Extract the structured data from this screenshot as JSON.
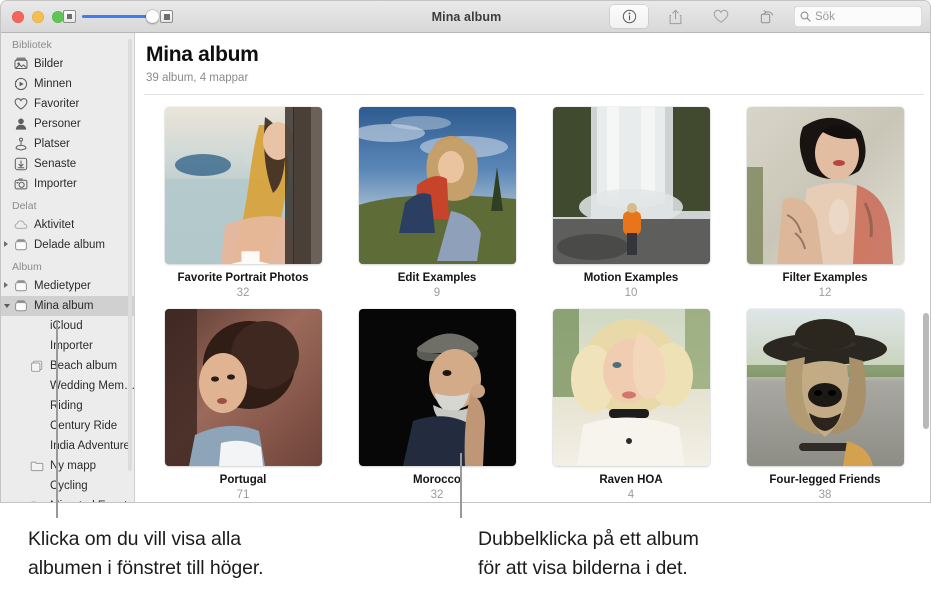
{
  "window": {
    "title": "Mina album",
    "traffic_lights": [
      "close",
      "minimize",
      "zoom"
    ],
    "zoom_slider": {
      "min_icon": "small-thumbnail-icon",
      "max_icon": "large-thumbnail-icon",
      "value_percent": 100
    }
  },
  "toolbar": {
    "buttons": [
      {
        "name": "info-button",
        "icon": "info-circle-icon"
      },
      {
        "name": "share-button",
        "icon": "share-up-arrow-icon"
      },
      {
        "name": "favorite-button",
        "icon": "heart-icon"
      },
      {
        "name": "rotate-button",
        "icon": "rotate-icon"
      }
    ],
    "search": {
      "placeholder": "Sök",
      "value": "",
      "icon": "search-icon"
    }
  },
  "sidebar": {
    "sections": [
      {
        "header": "Bibliotek",
        "items": [
          {
            "label": "Bilder",
            "icon": "photos-icon",
            "indent": false,
            "disclosure": "none",
            "selected": false
          },
          {
            "label": "Minnen",
            "icon": "memories-icon",
            "indent": false,
            "disclosure": "none",
            "selected": false
          },
          {
            "label": "Favoriter",
            "icon": "heart-icon",
            "indent": false,
            "disclosure": "none",
            "selected": false
          },
          {
            "label": "Personer",
            "icon": "person-icon",
            "indent": false,
            "disclosure": "none",
            "selected": false
          },
          {
            "label": "Platser",
            "icon": "pin-icon",
            "indent": false,
            "disclosure": "none",
            "selected": false
          },
          {
            "label": "Senaste",
            "icon": "download-icon",
            "indent": false,
            "disclosure": "none",
            "selected": false
          },
          {
            "label": "Importer",
            "icon": "camera-icon",
            "indent": false,
            "disclosure": "none",
            "selected": false
          }
        ]
      },
      {
        "header": "Delat",
        "items": [
          {
            "label": "Aktivitet",
            "icon": "cloud-icon",
            "indent": false,
            "disclosure": "none",
            "selected": false
          },
          {
            "label": "Delade album",
            "icon": "album-icon",
            "indent": false,
            "disclosure": "closed",
            "selected": false
          }
        ]
      },
      {
        "header": "Album",
        "items": [
          {
            "label": "Medietyper",
            "icon": "album-icon",
            "indent": false,
            "disclosure": "closed",
            "selected": false
          },
          {
            "label": "Mina album",
            "icon": "album-icon",
            "indent": false,
            "disclosure": "open",
            "selected": true
          },
          {
            "label": "iCloud",
            "icon": "thumb-icloud",
            "indent": true,
            "disclosure": "none",
            "selected": false
          },
          {
            "label": "Importer",
            "icon": "thumb-importer",
            "indent": true,
            "disclosure": "none",
            "selected": false
          },
          {
            "label": "Beach album",
            "icon": "stack-icon",
            "indent": true,
            "disclosure": "none",
            "selected": false
          },
          {
            "label": "Wedding Mem…",
            "icon": "thumb-wedding",
            "indent": true,
            "disclosure": "none",
            "selected": false
          },
          {
            "label": "Riding",
            "icon": "thumb-riding",
            "indent": true,
            "disclosure": "none",
            "selected": false
          },
          {
            "label": "Century Ride",
            "icon": "thumb-century",
            "indent": true,
            "disclosure": "none",
            "selected": false
          },
          {
            "label": "India Adventure",
            "icon": "thumb-india",
            "indent": true,
            "disclosure": "none",
            "selected": false
          },
          {
            "label": "Ny mapp",
            "icon": "folder-icon",
            "indent": true,
            "disclosure": "none",
            "selected": false
          },
          {
            "label": "Cycling",
            "icon": "thumb-cycling",
            "indent": true,
            "disclosure": "none",
            "selected": false
          },
          {
            "label": "Migrated Events",
            "icon": "folder-icon",
            "indent": true,
            "disclosure": "none",
            "selected": false
          }
        ]
      }
    ]
  },
  "main": {
    "title": "Mina album",
    "subtitle": "39 album, 4 mappar",
    "albums": [
      {
        "title": "Favorite Portrait Photos",
        "count": "32",
        "image": "woman-by-harbor",
        "badge": "gear-icon"
      },
      {
        "title": "Edit Examples",
        "count": "9",
        "image": "woman-in-field",
        "badge": null
      },
      {
        "title": "Motion Examples",
        "count": "10",
        "image": "waterfall-person",
        "badge": null
      },
      {
        "title": "Filter Examples",
        "count": "12",
        "image": "tattooed-woman",
        "badge": null
      },
      {
        "title": "Portugal",
        "count": "71",
        "image": "curly-hair-woman",
        "badge": null
      },
      {
        "title": "Morocco",
        "count": "32",
        "image": "older-man-cap",
        "badge": null
      },
      {
        "title": "Raven HOA",
        "count": "4",
        "image": "blonde-woman",
        "badge": null
      },
      {
        "title": "Four-legged Friends",
        "count": "38",
        "image": "dog-with-hat",
        "badge": null
      }
    ]
  },
  "callouts": [
    {
      "name": "sidebar-callout",
      "text_line1": "Klicka om du vill visa alla",
      "text_line2": "albumen i fönstret till höger."
    },
    {
      "name": "album-callout",
      "text_line1": "Dubbelklicka på ett album",
      "text_line2": "för att visa bilderna i det."
    }
  ],
  "colors": {
    "accent": "#3d7ef5",
    "sidebar_bg": "#ececec",
    "selection": "#d0d0d0",
    "title_text": "#0f0f0f",
    "subtitle_text": "#8a8a8a"
  }
}
